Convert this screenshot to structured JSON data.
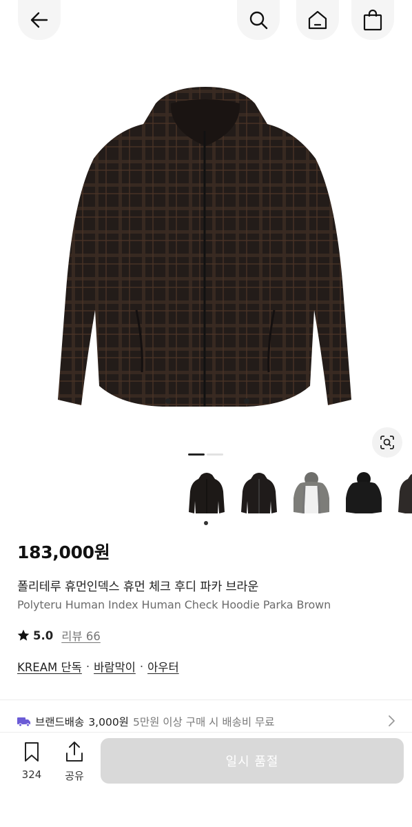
{
  "icons": {
    "back": "arrow-left-icon",
    "search": "search-icon",
    "home": "home-icon",
    "bag": "shopping-bag-icon",
    "lens": "image-search-icon",
    "star": "star-icon",
    "truck": "truck-icon",
    "chevron": "chevron-right-icon",
    "bookmark": "bookmark-icon",
    "share": "share-icon"
  },
  "gallery": {
    "total_images": 2,
    "current_index": 1
  },
  "thumbnails": [
    {
      "variant": "black check hoodie",
      "selected": true
    },
    {
      "variant": "black check hoodie alt",
      "selected": false
    },
    {
      "variant": "grey hoodie",
      "selected": false
    },
    {
      "variant": "black hoodie",
      "selected": false
    },
    {
      "variant": "dark hoodie",
      "selected": false
    }
  ],
  "product": {
    "price": "183,000원",
    "title_ko": "폴리테루 휴먼인덱스 휴먼 체크 후디 파카 브라운",
    "title_en": "Polyteru Human Index Human Check Hoodie Parka Brown",
    "rating": "5.0",
    "review_label": "리뷰 66",
    "tags": [
      "KREAM 단독",
      "바람막이",
      "아우터"
    ],
    "tag_separator": "·"
  },
  "shipping": {
    "label": "브랜드배송",
    "fee": "3,000원",
    "note": "5만원 이상 구매 시 배송비 무료"
  },
  "bottom_bar": {
    "save_count": "324",
    "share_label": "공유",
    "buy_button_label": "일시 품절"
  },
  "colors": {
    "accent_truck": "#6b5bd6",
    "soldout_button": "#d9d9d9",
    "text_primary": "#111111",
    "text_secondary": "#6b6b6b"
  }
}
